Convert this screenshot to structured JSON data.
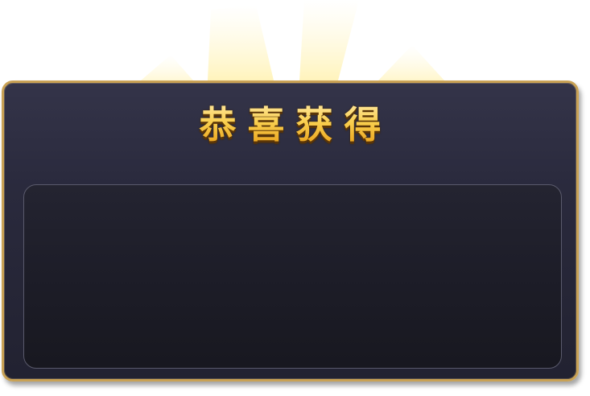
{
  "dialog": {
    "title": "恭喜获得"
  },
  "colors": {
    "frame_gold": "#c9a255",
    "title_gold": "#f6c340",
    "panel_bg": "#2a2a3d",
    "content_bg": "#1d1d28"
  },
  "icons": [
    "light-rays-glow"
  ]
}
